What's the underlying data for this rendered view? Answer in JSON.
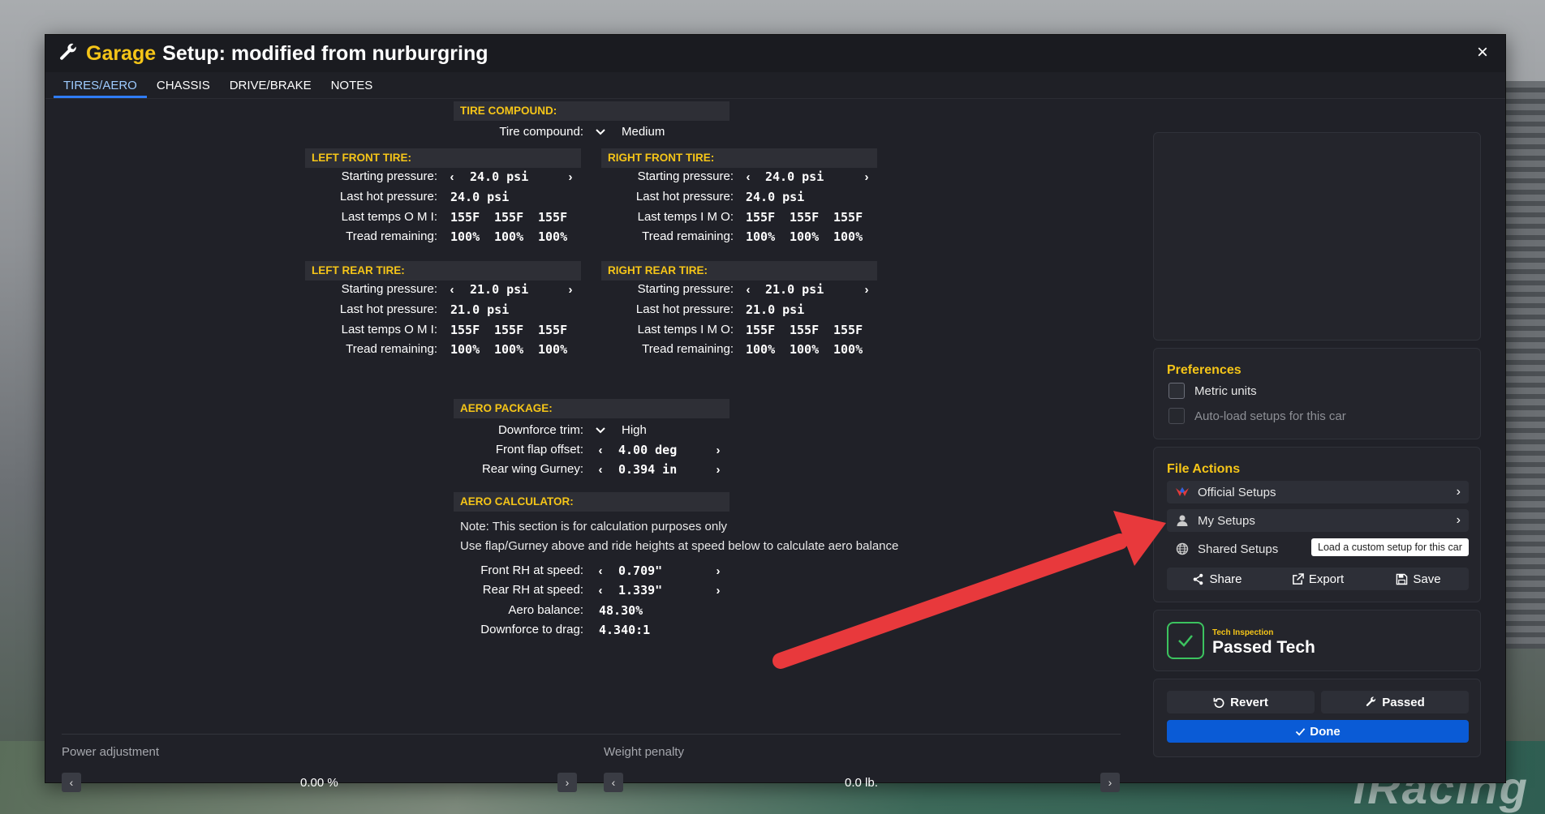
{
  "window": {
    "title_garage": "Garage",
    "title_setup": "Setup: modified from nurburgring",
    "close_glyph": "×"
  },
  "tabs": [
    {
      "label": "TIRES/AERO",
      "active": true
    },
    {
      "label": "CHASSIS",
      "active": false
    },
    {
      "label": "DRIVE/BRAKE",
      "active": false
    },
    {
      "label": "NOTES",
      "active": false
    }
  ],
  "tire_compound": {
    "header": "TIRE COMPOUND:",
    "label": "Tire compound:",
    "value": "Medium"
  },
  "left_front": {
    "header": "LEFT FRONT TIRE:",
    "starting_pressure_label": "Starting pressure:",
    "starting_pressure": "24.0 psi",
    "last_hot_label": "Last hot pressure:",
    "last_hot": "24.0 psi",
    "temps_label": "Last temps O M I:",
    "temps": [
      "155F",
      "155F",
      "155F"
    ],
    "tread_label": "Tread remaining:",
    "tread": [
      "100%",
      "100%",
      "100%"
    ]
  },
  "right_front": {
    "header": "RIGHT FRONT TIRE:",
    "starting_pressure_label": "Starting pressure:",
    "starting_pressure": "24.0 psi",
    "last_hot_label": "Last hot pressure:",
    "last_hot": "24.0 psi",
    "temps_label": "Last temps I M O:",
    "temps": [
      "155F",
      "155F",
      "155F"
    ],
    "tread_label": "Tread remaining:",
    "tread": [
      "100%",
      "100%",
      "100%"
    ]
  },
  "left_rear": {
    "header": "LEFT REAR TIRE:",
    "starting_pressure_label": "Starting pressure:",
    "starting_pressure": "21.0 psi",
    "last_hot_label": "Last hot pressure:",
    "last_hot": "21.0 psi",
    "temps_label": "Last temps O M I:",
    "temps": [
      "155F",
      "155F",
      "155F"
    ],
    "tread_label": "Tread remaining:",
    "tread": [
      "100%",
      "100%",
      "100%"
    ]
  },
  "right_rear": {
    "header": "RIGHT REAR TIRE:",
    "starting_pressure_label": "Starting pressure:",
    "starting_pressure": "21.0 psi",
    "last_hot_label": "Last hot pressure:",
    "last_hot": "21.0 psi",
    "temps_label": "Last temps I M O:",
    "temps": [
      "155F",
      "155F",
      "155F"
    ],
    "tread_label": "Tread remaining:",
    "tread": [
      "100%",
      "100%",
      "100%"
    ]
  },
  "aero": {
    "header": "AERO PACKAGE:",
    "downforce_label": "Downforce trim:",
    "downforce": "High",
    "flap_label": "Front flap offset:",
    "flap": "4.00 deg",
    "gurney_label": "Rear wing Gurney:",
    "gurney": "0.394 in"
  },
  "calc": {
    "header": "AERO CALCULATOR:",
    "note1": "Note: This section is for calculation purposes only",
    "note2": "Use flap/Gurney above and ride heights at speed below to calculate aero balance",
    "front_rh_label": "Front RH at speed:",
    "front_rh": "0.709\"",
    "rear_rh_label": "Rear RH at speed:",
    "rear_rh": "1.339\"",
    "balance_label": "Aero balance:",
    "balance": "48.30%",
    "drag_label": "Downforce to drag:",
    "drag": "4.340:1"
  },
  "bottom": {
    "power_label": "Power adjustment",
    "power_value": "0.00 %",
    "weight_label": "Weight penalty",
    "weight_value": "0.0 lb."
  },
  "preferences": {
    "title": "Preferences",
    "metric": "Metric units",
    "autoload": "Auto-load setups for this car"
  },
  "file_actions": {
    "title": "File Actions",
    "official": "Official Setups",
    "my": "My Setups",
    "shared": "Shared Setups",
    "tooltip": "Load a custom setup for this car",
    "share": "Share",
    "export": "Export",
    "save": "Save"
  },
  "tech": {
    "small": "Tech Inspection",
    "big": "Passed Tech"
  },
  "actions": {
    "revert": "Revert",
    "passed": "Passed",
    "done": "Done"
  },
  "background": {
    "logo_text": "iRacing"
  },
  "colors": {
    "accent_yellow": "#f5c518",
    "tab_active": "#2f7cf6",
    "done_blue": "#0a5bd6",
    "tech_green": "#3cc35f",
    "arrow_red": "#e8393c"
  }
}
